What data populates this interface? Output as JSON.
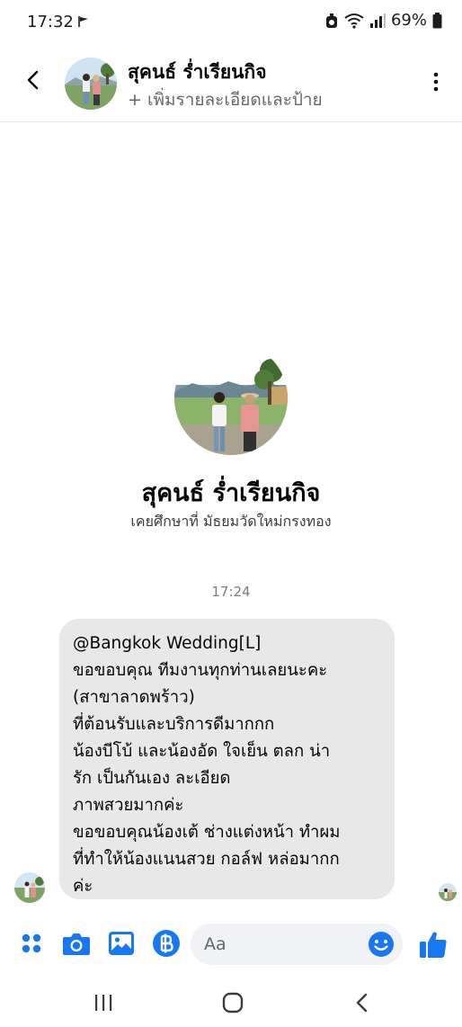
{
  "status_bar": {
    "time": "17:32",
    "battery": "69%",
    "icons": [
      "flag-icon",
      "alarm-icon",
      "wifi-icon",
      "signal-icon",
      "battery-icon"
    ]
  },
  "header": {
    "name": "สุคนธ์ ร่ำเรียนกิจ",
    "subtitle": "+ เพิ่มรายละเอียดและป้าย"
  },
  "profile": {
    "name": "สุคนธ์ ร่ำเรียนกิจ",
    "info": "เคยศึกษาที่ มัธยมวัดใหม่กรงทอง"
  },
  "conversation": {
    "timestamp": "17:24",
    "message_lines": [
      "@Bangkok Wedding[L]",
      "ขอขอบคุณ ทีมงานทุกท่านเลยนะคะ",
      "(สาขาลาดพร้าว)",
      "ที่ต้อนรับและบริการดีมากกก",
      "น้องบีโบ้ และน้องอัด ใจเย็น ตลก น่า",
      "รัก เป็นกันเอง ละเอียด",
      "ภาพสวยมากค่ะ",
      "ขอขอบคุณน้องเต้  ช่างแต่งหน้า ทำผม",
      "ที่ทำให้น้องแนนสวย กอล์ฟ หล่อมากก",
      "ค่ะ"
    ]
  },
  "composer": {
    "placeholder": "Aa",
    "accent": "#1877f2"
  }
}
